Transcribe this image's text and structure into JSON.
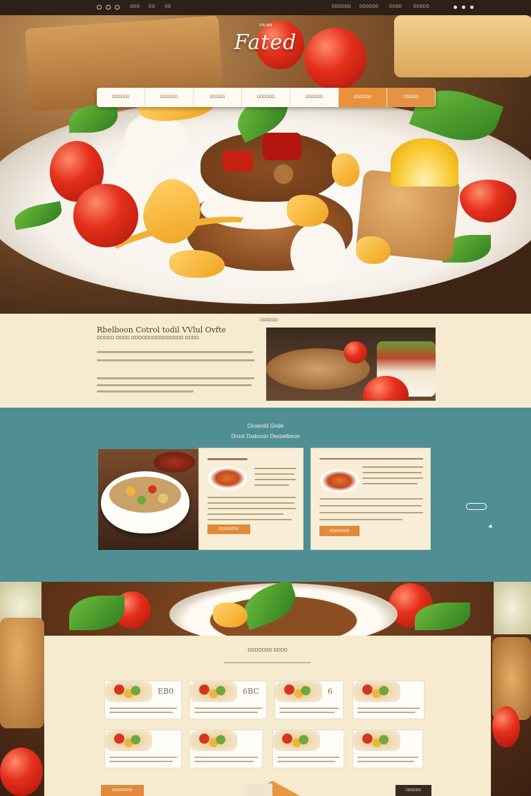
{
  "topbar": {
    "left_links": [
      "GDD",
      "DO",
      "GD"
    ],
    "right_links": [
      "DDDDDD",
      "DDDDDD",
      "DDDD",
      "DDDDD"
    ]
  },
  "hero": {
    "brand": "Fated",
    "tagline": "ITALIAN",
    "nav": [
      "DDDDDD",
      "DDDDDD",
      "DDDDD",
      "DDDDDD",
      "DDDDDD",
      "DDDDDD",
      "DDDDD"
    ]
  },
  "about": {
    "tag": "DDDDDD",
    "title": "Rbelboon Cotrol todil VVlul Ovfte",
    "subtitle": "DDDDD ODDD DDDDDDDDDDDDDDD DDDD"
  },
  "featured": {
    "title": "Ocoerdd Gride",
    "subtitle": "Droot Dxdooon Dexoetbeon",
    "card_buttons": [
      "DDDDDDDD",
      "DDDDDDDD"
    ]
  },
  "menu": {
    "title": "DDDDDDD DDDD",
    "tile_labels": [
      "EB0",
      "6BC",
      "6",
      "",
      "",
      "",
      "",
      ""
    ],
    "button_left": "DDDDDDDD",
    "button_right": "DDDDDD"
  },
  "colors": {
    "accent": "#e8933b",
    "teal": "#4f8f94",
    "cream": "#f6ebd0",
    "dark": "#2c2018"
  }
}
